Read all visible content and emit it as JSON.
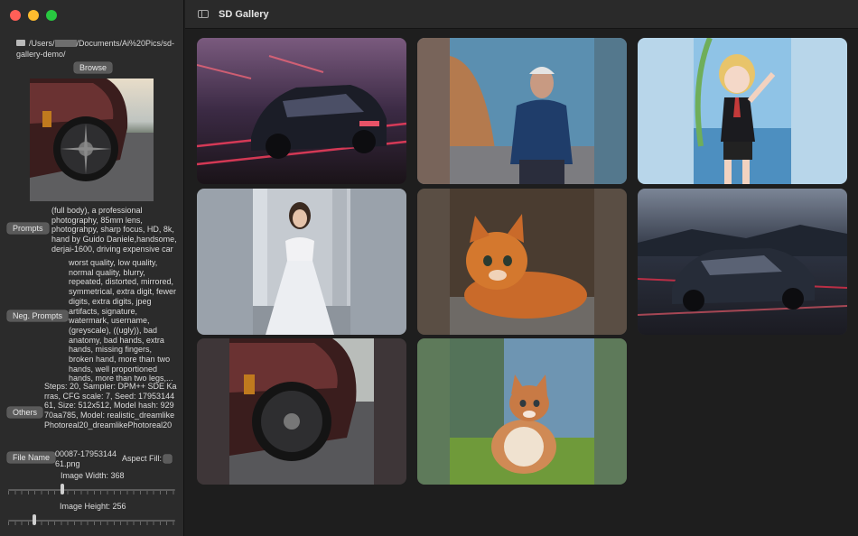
{
  "window": {
    "title": "SD Gallery"
  },
  "sidebar": {
    "path_prefix": "/Users/",
    "path_suffix": "/Documents/Ai%20Pics/sd-gallery-demo/",
    "browse_label": "Browse",
    "prompts_label": "Prompts",
    "prompts_text": "(full body), a professional photography, 85mm lens, photograhpy, sharp focus, HD, 8k, hand by Guido Daniele,handsome, derjai-1600, driving expensive car",
    "neg_label": "Neg. Prompts",
    "neg_text": "worst quality, low quality, normal quality, blurry, repeated, distorted, mirrored, symmetrical, extra digit, fewer digits, extra digits, jpeg artifacts, signature, watermark, username, (greyscale), ((ugly)), bad anatomy, bad hands, extra hands, missing fingers, broken hand, more than two hands, well proportioned hands, more than two legs,...",
    "others_label": "Others",
    "others_text": "Steps: 20, Sampler: DPM++ SDE Karras, CFG scale: 7, Seed: 1795314461, Size: 512x512, Model hash: 92970aa785, Model: realistic_dreamlikePhotoreal20_dreamlikePhotoreal20",
    "filename_label": "File Name",
    "filename_text": "00087-1795314461.png",
    "aspect_fill_label": "Aspect Fill:",
    "aspect_fill_checked": false,
    "width_label": "Image Width: 368",
    "width_value": 368,
    "height_label": "Image Height: 256",
    "height_value": 256
  },
  "gallery": {
    "images": [
      {
        "subject": "car-neon-night"
      },
      {
        "subject": "old-man-portrait"
      },
      {
        "subject": "anime-girl"
      },
      {
        "subject": "bride-white-dress"
      },
      {
        "subject": "orange-kitten-crouching"
      },
      {
        "subject": "car-dusk-road"
      },
      {
        "subject": "car-wheel-closeup"
      },
      {
        "subject": "kitten-in-grass"
      }
    ]
  },
  "colors": {
    "accent_red": "#ff5f57",
    "accent_yellow": "#febc2e",
    "accent_green": "#28c840"
  }
}
